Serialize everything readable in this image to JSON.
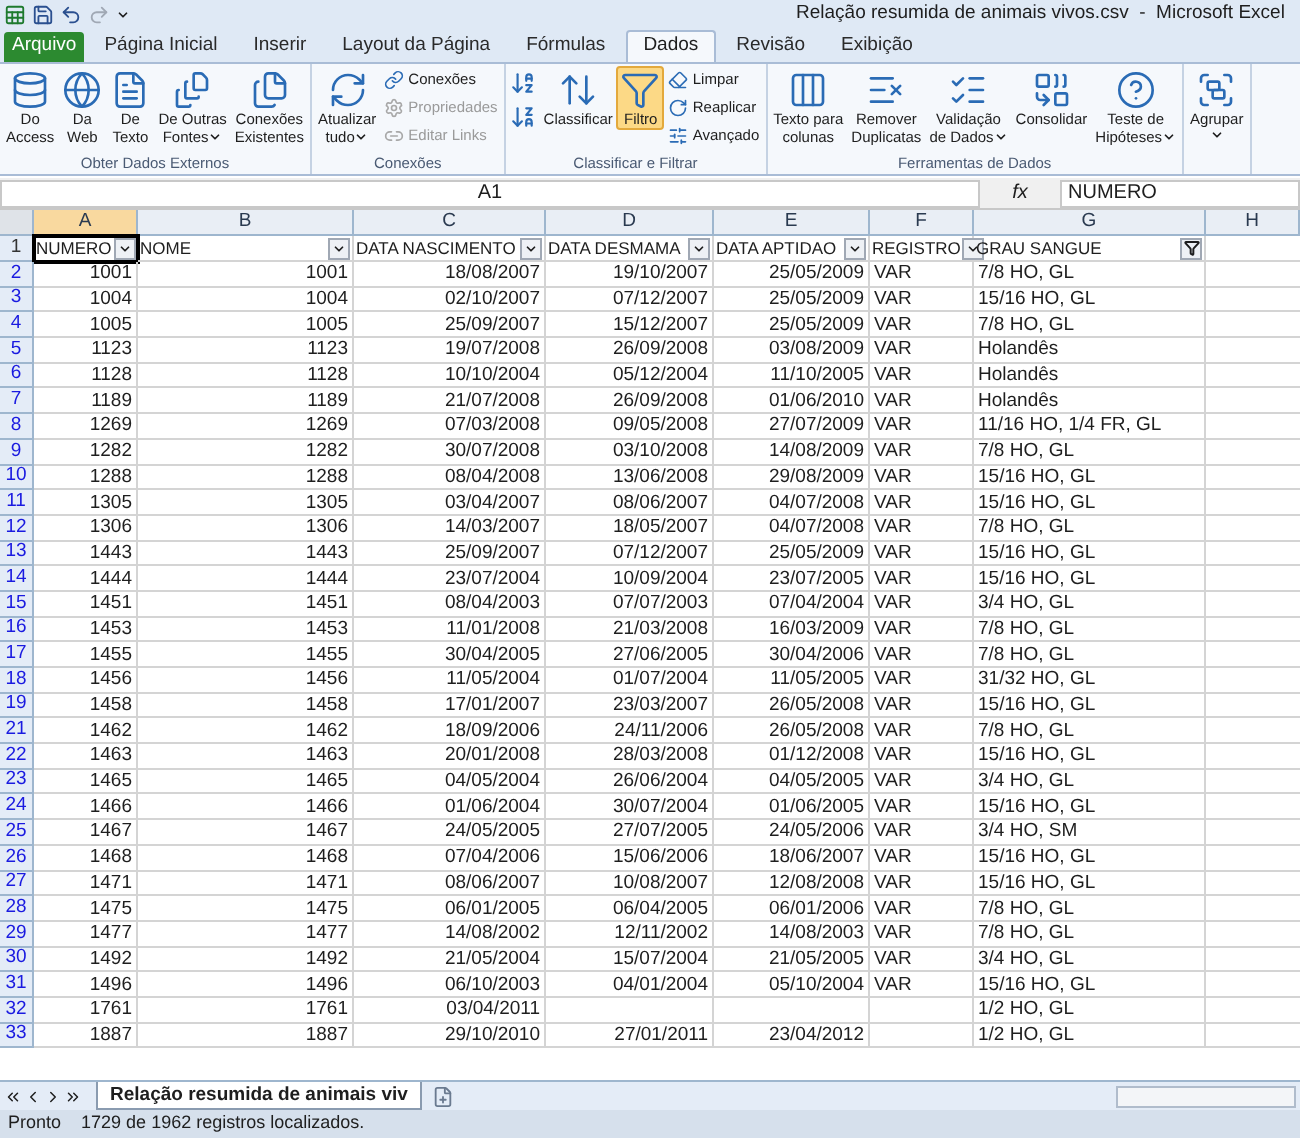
{
  "window": {
    "title": "Relação resumida de animais vivos.csv  -  Microsoft Excel"
  },
  "ribbon_tabs": [
    {
      "label": "Arquivo",
      "kind": "file",
      "selected": false
    },
    {
      "label": "Página Inicial",
      "kind": "tab",
      "selected": false
    },
    {
      "label": "Inserir",
      "kind": "tab",
      "selected": false
    },
    {
      "label": "Layout da Página",
      "kind": "tab",
      "selected": false
    },
    {
      "label": "Fórmulas",
      "kind": "tab",
      "selected": false
    },
    {
      "label": "Dados",
      "kind": "tab",
      "selected": true
    },
    {
      "label": "Revisão",
      "kind": "tab",
      "selected": false
    },
    {
      "label": "Exibição",
      "kind": "tab",
      "selected": false
    }
  ],
  "ribbon_groups": [
    {
      "label": "Obter Dados Externos",
      "buttons": [
        {
          "kind": "large",
          "lines": [
            "Do",
            "Access"
          ],
          "dropdown": false
        },
        {
          "kind": "large",
          "lines": [
            "Da",
            "Web"
          ],
          "dropdown": false
        },
        {
          "kind": "large",
          "lines": [
            "De",
            "Texto"
          ],
          "dropdown": false
        },
        {
          "kind": "large",
          "lines": [
            "De Outras",
            "Fontes"
          ],
          "dropdown": true
        },
        {
          "kind": "large",
          "lines": [
            "Conexões",
            "Existentes"
          ],
          "dropdown": false
        }
      ]
    },
    {
      "label": "Conexões",
      "buttons": [
        {
          "kind": "large",
          "lines": [
            "Atualizar",
            "tudo"
          ],
          "dropdown": true
        },
        {
          "kind": "small",
          "lines": [
            "Conexões"
          ],
          "disabled": false
        },
        {
          "kind": "small",
          "lines": [
            "Propriedades"
          ],
          "disabled": true
        },
        {
          "kind": "small",
          "lines": [
            "Editar Links"
          ],
          "disabled": true
        }
      ]
    },
    {
      "label": "Classificar e Filtrar",
      "buttons": [
        {
          "kind": "icon"
        },
        {
          "kind": "icon"
        },
        {
          "kind": "large",
          "lines": [
            "Classificar"
          ],
          "selected": false
        },
        {
          "kind": "large",
          "lines": [
            "Filtro"
          ],
          "selected": true
        },
        {
          "kind": "small",
          "lines": [
            "Limpar"
          ]
        },
        {
          "kind": "small",
          "lines": [
            "Reaplicar"
          ]
        },
        {
          "kind": "small",
          "lines": [
            "Avançado"
          ]
        }
      ]
    },
    {
      "label": "Ferramentas de Dados",
      "buttons": [
        {
          "kind": "large",
          "lines": [
            "Texto para",
            "colunas"
          ],
          "dropdown": false
        },
        {
          "kind": "large",
          "lines": [
            "Remover",
            "Duplicatas"
          ],
          "dropdown": false
        },
        {
          "kind": "large",
          "lines": [
            "Validação",
            "de Dados"
          ],
          "dropdown": true
        },
        {
          "kind": "large",
          "lines": [
            "Consolidar"
          ],
          "dropdown": false
        },
        {
          "kind": "large",
          "lines": [
            "Teste de",
            "Hipóteses"
          ],
          "dropdown": true
        }
      ]
    },
    {
      "buttons": [
        {
          "kind": "large",
          "lines": [
            "Agrupar"
          ],
          "dropdown": true
        }
      ]
    }
  ],
  "formula_bar": {
    "name_box": "A1",
    "fx": "fx",
    "value": "NUMERO"
  },
  "columns": [
    {
      "label": "A",
      "selected": true
    },
    {
      "label": "B",
      "selected": false
    },
    {
      "label": "C",
      "selected": false
    },
    {
      "label": "D",
      "selected": false
    },
    {
      "label": "E",
      "selected": false
    },
    {
      "label": "F",
      "selected": false
    },
    {
      "label": "G",
      "selected": false
    },
    {
      "label": "H",
      "selected": false
    }
  ],
  "header_row": {
    "row": "1",
    "cells": [
      {
        "text": "NUMERO",
        "filter_active": false
      },
      {
        "text": "NOME",
        "filter_active": false
      },
      {
        "text": "DATA NASCIMENTO",
        "filter_active": false
      },
      {
        "text": "DATA DESMAMA",
        "filter_active": false
      },
      {
        "text": "DATA APTIDAO",
        "filter_active": false
      },
      {
        "text": "REGISTRO",
        "filter_active": false
      },
      {
        "text": "GRAU SANGUE",
        "filter_active": true
      }
    ]
  },
  "rows": [
    {
      "row": "2",
      "cells": [
        "1001",
        "1001",
        "18/08/2007",
        "19/10/2007",
        "25/05/2009",
        "VAR",
        "7/8 HO, GL"
      ]
    },
    {
      "row": "3",
      "cells": [
        "1004",
        "1004",
        "02/10/2007",
        "07/12/2007",
        "25/05/2009",
        "VAR",
        "15/16 HO, GL"
      ]
    },
    {
      "row": "4",
      "cells": [
        "1005",
        "1005",
        "25/09/2007",
        "15/12/2007",
        "25/05/2009",
        "VAR",
        "7/8 HO, GL"
      ]
    },
    {
      "row": "5",
      "cells": [
        "1123",
        "1123",
        "19/07/2008",
        "26/09/2008",
        "03/08/2009",
        "VAR",
        "Holandês"
      ]
    },
    {
      "row": "6",
      "cells": [
        "1128",
        "1128",
        "10/10/2004",
        "05/12/2004",
        "11/10/2005",
        "VAR",
        "Holandês"
      ]
    },
    {
      "row": "7",
      "cells": [
        "1189",
        "1189",
        "21/07/2008",
        "26/09/2008",
        "01/06/2010",
        "VAR",
        "Holandês"
      ]
    },
    {
      "row": "8",
      "cells": [
        "1269",
        "1269",
        "07/03/2008",
        "09/05/2008",
        "27/07/2009",
        "VAR",
        "11/16 HO, 1/4 FR, GL"
      ]
    },
    {
      "row": "9",
      "cells": [
        "1282",
        "1282",
        "30/07/2008",
        "03/10/2008",
        "14/08/2009",
        "VAR",
        "7/8 HO, GL"
      ]
    },
    {
      "row": "10",
      "cells": [
        "1288",
        "1288",
        "08/04/2008",
        "13/06/2008",
        "29/08/2009",
        "VAR",
        "15/16 HO, GL"
      ]
    },
    {
      "row": "11",
      "cells": [
        "1305",
        "1305",
        "03/04/2007",
        "08/06/2007",
        "04/07/2008",
        "VAR",
        "15/16 HO, GL"
      ]
    },
    {
      "row": "12",
      "cells": [
        "1306",
        "1306",
        "14/03/2007",
        "18/05/2007",
        "04/07/2008",
        "VAR",
        "7/8 HO, GL"
      ]
    },
    {
      "row": "13",
      "cells": [
        "1443",
        "1443",
        "25/09/2007",
        "07/12/2007",
        "25/05/2009",
        "VAR",
        "15/16 HO, GL"
      ]
    },
    {
      "row": "14",
      "cells": [
        "1444",
        "1444",
        "23/07/2004",
        "10/09/2004",
        "23/07/2005",
        "VAR",
        "15/16 HO, GL"
      ]
    },
    {
      "row": "15",
      "cells": [
        "1451",
        "1451",
        "08/04/2003",
        "07/07/2003",
        "07/04/2004",
        "VAR",
        "3/4 HO, GL"
      ]
    },
    {
      "row": "16",
      "cells": [
        "1453",
        "1453",
        "11/01/2008",
        "21/03/2008",
        "16/03/2009",
        "VAR",
        "7/8 HO, GL"
      ]
    },
    {
      "row": "17",
      "cells": [
        "1455",
        "1455",
        "30/04/2005",
        "27/06/2005",
        "30/04/2006",
        "VAR",
        "7/8 HO, GL"
      ]
    },
    {
      "row": "18",
      "cells": [
        "1456",
        "1456",
        "11/05/2004",
        "01/07/2004",
        "11/05/2005",
        "VAR",
        "31/32 HO, GL"
      ]
    },
    {
      "row": "19",
      "cells": [
        "1458",
        "1458",
        "17/01/2007",
        "23/03/2007",
        "26/05/2008",
        "VAR",
        "15/16 HO, GL"
      ]
    },
    {
      "row": "21",
      "cells": [
        "1462",
        "1462",
        "18/09/2006",
        "24/11/2006",
        "26/05/2008",
        "VAR",
        "7/8 HO, GL"
      ]
    },
    {
      "row": "22",
      "cells": [
        "1463",
        "1463",
        "20/01/2008",
        "28/03/2008",
        "01/12/2008",
        "VAR",
        "15/16 HO, GL"
      ]
    },
    {
      "row": "23",
      "cells": [
        "1465",
        "1465",
        "04/05/2004",
        "26/06/2004",
        "04/05/2005",
        "VAR",
        "3/4 HO, GL"
      ]
    },
    {
      "row": "24",
      "cells": [
        "1466",
        "1466",
        "01/06/2004",
        "30/07/2004",
        "01/06/2005",
        "VAR",
        "15/16 HO, GL"
      ]
    },
    {
      "row": "25",
      "cells": [
        "1467",
        "1467",
        "24/05/2005",
        "27/07/2005",
        "24/05/2006",
        "VAR",
        "3/4 HO, SM"
      ]
    },
    {
      "row": "26",
      "cells": [
        "1468",
        "1468",
        "07/04/2006",
        "15/06/2006",
        "18/06/2007",
        "VAR",
        "15/16 HO, GL"
      ]
    },
    {
      "row": "27",
      "cells": [
        "1471",
        "1471",
        "08/06/2007",
        "10/08/2007",
        "12/08/2008",
        "VAR",
        "15/16 HO, GL"
      ]
    },
    {
      "row": "28",
      "cells": [
        "1475",
        "1475",
        "06/01/2005",
        "06/04/2005",
        "06/01/2006",
        "VAR",
        "7/8 HO, GL"
      ]
    },
    {
      "row": "29",
      "cells": [
        "1477",
        "1477",
        "14/08/2002",
        "12/11/2002",
        "14/08/2003",
        "VAR",
        "7/8 HO, GL"
      ]
    },
    {
      "row": "30",
      "cells": [
        "1492",
        "1492",
        "21/05/2004",
        "15/07/2004",
        "21/05/2005",
        "VAR",
        "3/4 HO, GL"
      ]
    },
    {
      "row": "31",
      "cells": [
        "1496",
        "1496",
        "06/10/2003",
        "04/01/2004",
        "05/10/2004",
        "VAR",
        "15/16 HO, GL"
      ]
    },
    {
      "row": "32",
      "cells": [
        "1761",
        "1761",
        "03/04/2011",
        null,
        null,
        null,
        "1/2 HO, GL"
      ]
    },
    {
      "row": "33",
      "cells": [
        "1887",
        "1887",
        "29/10/2010",
        "27/01/2011",
        "23/04/2012",
        null,
        "1/2 HO, GL"
      ]
    }
  ],
  "sheet_tabs": [
    {
      "label": "Relação resumida de animais viv",
      "selected": true
    }
  ],
  "status_bar": {
    "mode": "Pronto",
    "message": "1729 de 1962 registros localizados."
  }
}
